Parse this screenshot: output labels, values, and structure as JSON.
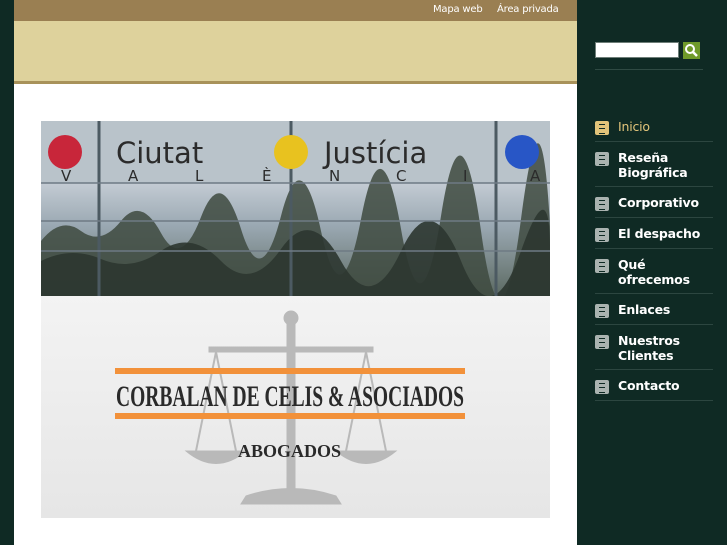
{
  "topbar": {
    "links": [
      "Mapa web",
      "Área privada"
    ]
  },
  "banner": {
    "sign_line1_left": "Ciutat",
    "sign_line1_right": "Justícia",
    "sign_line2": [
      "V",
      "A",
      "L",
      "È",
      "N",
      "C",
      "I",
      "A"
    ],
    "firm_name": "CORBALAN DE CELIS  &  ASOCIADOS",
    "firm_subtitle": "ABOGADOS"
  },
  "search": {
    "placeholder": "",
    "button_icon": "search-icon"
  },
  "menu": {
    "items": [
      {
        "label": "Inicio",
        "active": true
      },
      {
        "label": "Reseña Biográfica",
        "active": false
      },
      {
        "label": "Corporativo",
        "active": false
      },
      {
        "label": "El despacho",
        "active": false
      },
      {
        "label": "Qué ofrecemos",
        "active": false
      },
      {
        "label": "Enlaces",
        "active": false
      },
      {
        "label": "Nuestros Clientes",
        "active": false
      },
      {
        "label": "Contacto",
        "active": false
      }
    ]
  },
  "colors": {
    "sidebar_bg": "#0f2a24",
    "topbar_bg": "#9a7f52",
    "header_bg": "#ded29c",
    "active_menu": "#e2c47a",
    "search_button": "#6f9a2a"
  }
}
